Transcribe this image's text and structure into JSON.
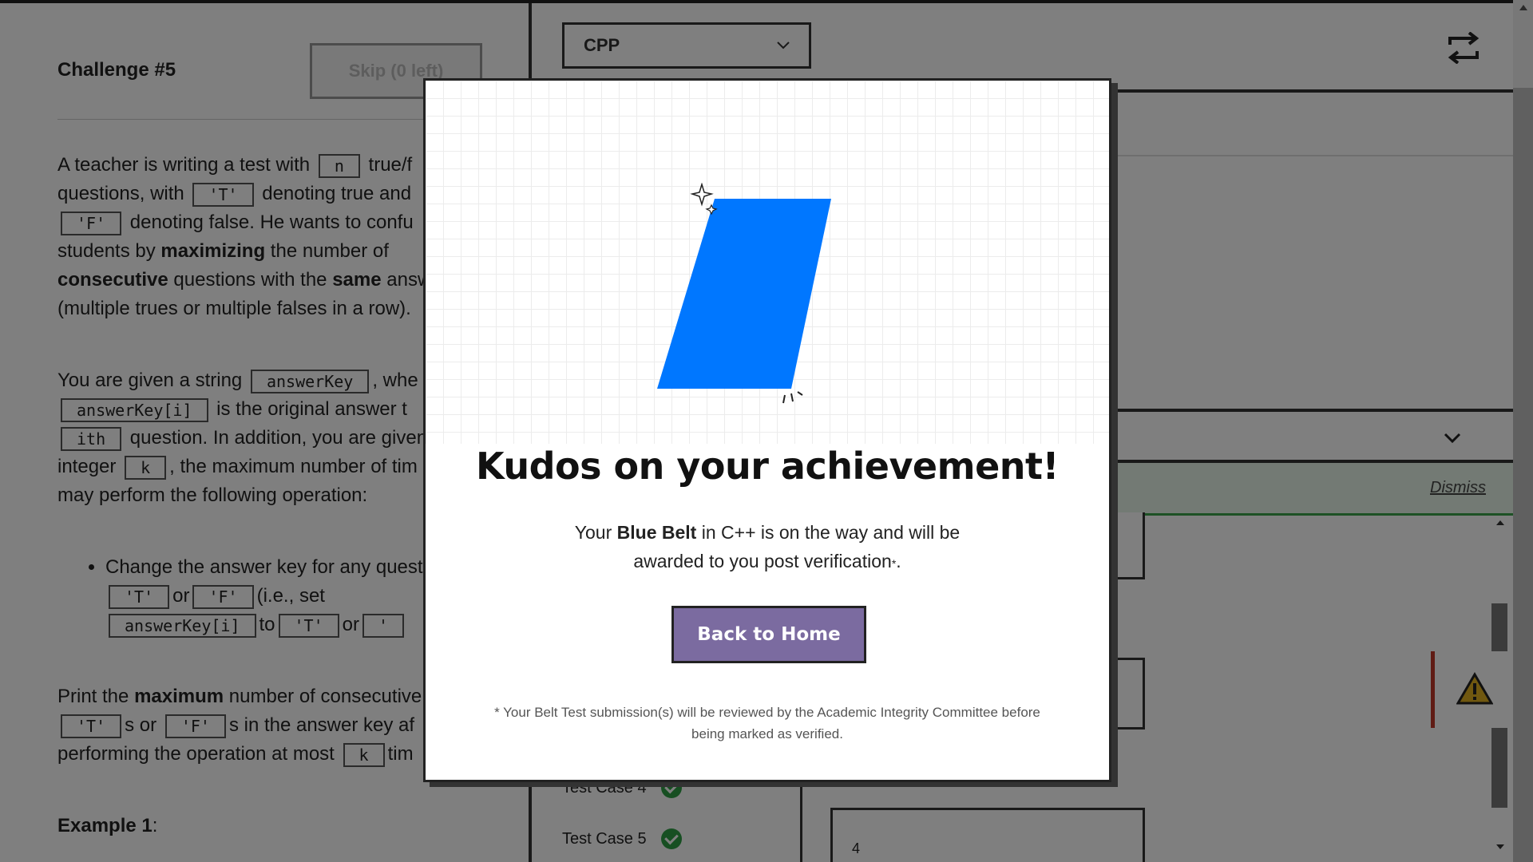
{
  "challenge": {
    "title": "Challenge #5",
    "skip_label": "Skip (0 left)",
    "p1": {
      "t1": "A teacher is writing a test with",
      "c1": "n",
      "t2": "true/f",
      "t3": "questions, with",
      "c2": "'T'",
      "t4": "denoting true and",
      "c3": "'F'",
      "t5": "denoting false. He wants to confu",
      "t6": "students by",
      "b1": "maximizing",
      "t7": "the number of",
      "b2": "consecutive",
      "t8": "questions with the",
      "b3": "same",
      "t9": "answ",
      "t10": "(multiple trues or multiple falses in a row)."
    },
    "p2": {
      "t1": "You are given a string",
      "c1": "answerKey",
      "t2": ", whe",
      "c2": "answerKey[i]",
      "t3": "is the original answer t",
      "c3": "ith",
      "t4": "question. In addition, you are given",
      "t5": "integer",
      "c4": "k",
      "t6": ", the maximum number of tim",
      "t7": "may perform the following operation:"
    },
    "bullet": {
      "t1": "Change the answer key for any questi",
      "c1": "'T'",
      "t2": "or",
      "c2": "'F'",
      "t3": "(i.e., set",
      "c3": "answerKey[i]",
      "t4": "to",
      "c4": "'T'",
      "t5": "or",
      "c5": "'"
    },
    "p3": {
      "t1": "Print the",
      "b1": "maximum",
      "t2": "number of consecutive",
      "c1": "'T'",
      "t3": "s or",
      "c2": "'F'",
      "t4": "s in the answer key af",
      "t5": "performing the operation at most",
      "c3": "k",
      "t6": "tim"
    },
    "example_title": "Example 1",
    "example_colon": ":"
  },
  "editor": {
    "language": "CPP"
  },
  "console": {
    "dismiss_label": "Dismiss",
    "tests": [
      {
        "label": "Test Case 4",
        "status": "passed"
      },
      {
        "label": "Test Case 5",
        "status": "passed"
      }
    ],
    "io_value": "4"
  },
  "modal": {
    "title": "Kudos on your achievement!",
    "body_pre": "Your",
    "belt": "Blue Belt",
    "body_mid": "in C++ is on the way and will be awarded to you post verification",
    "asterisk": "*",
    "body_end": ".",
    "button_label": "Back to Home",
    "footnote": "* Your Belt Test submission(s) will be reviewed by the Academic Integrity Committee before being marked as verified."
  },
  "colors": {
    "belt": "#0077ff",
    "button": "#7b6ba0",
    "success": "#2e9e44",
    "warning": "#c0392b"
  }
}
